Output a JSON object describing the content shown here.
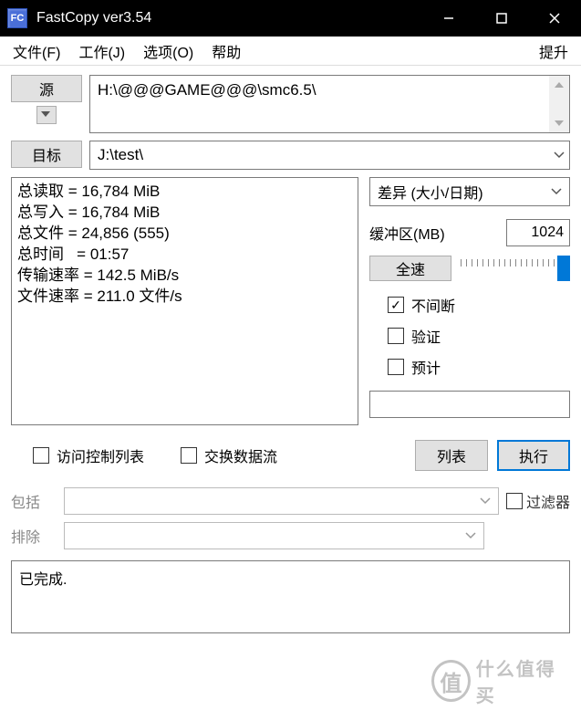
{
  "window": {
    "app_icon_text": "FC",
    "title": "FastCopy ver3.54"
  },
  "menu": {
    "file": "文件(F)",
    "job": "工作(J)",
    "options": "选项(O)",
    "help": "帮助",
    "elevate": "提升"
  },
  "paths": {
    "source_btn": "源",
    "source_value": "H:\\@@@GAME@@@\\smc6.5\\",
    "dest_btn": "目标",
    "dest_value": "J:\\test\\"
  },
  "stats": {
    "lines": {
      "total_read": "总读取 = 16,784 MiB",
      "total_write": "总写入 = 16,784 MiB",
      "total_files": "总文件 = 24,856 (555)",
      "total_time": "总时间   = 01:57",
      "trans_rate": "传输速率 = 142.5 MiB/s",
      "file_rate": "文件速率 = 211.0 文件/s"
    }
  },
  "mode": {
    "selected": "差异 (大小/日期)"
  },
  "buffer": {
    "label": "缓冲区(MB)",
    "value": "1024"
  },
  "speed": {
    "full_btn": "全速"
  },
  "checks": {
    "nonstop": "不间断",
    "verify": "验证",
    "estimate": "预计"
  },
  "bottom_checks": {
    "acl": "访问控制列表",
    "altstream": "交换数据流"
  },
  "actions": {
    "list": "列表",
    "execute": "执行"
  },
  "filters": {
    "include_label": "包括",
    "exclude_label": "排除",
    "filter_toggle": "过滤器"
  },
  "log": {
    "done": "已完成."
  },
  "watermark": {
    "char": "值",
    "text": "什么值得买"
  }
}
